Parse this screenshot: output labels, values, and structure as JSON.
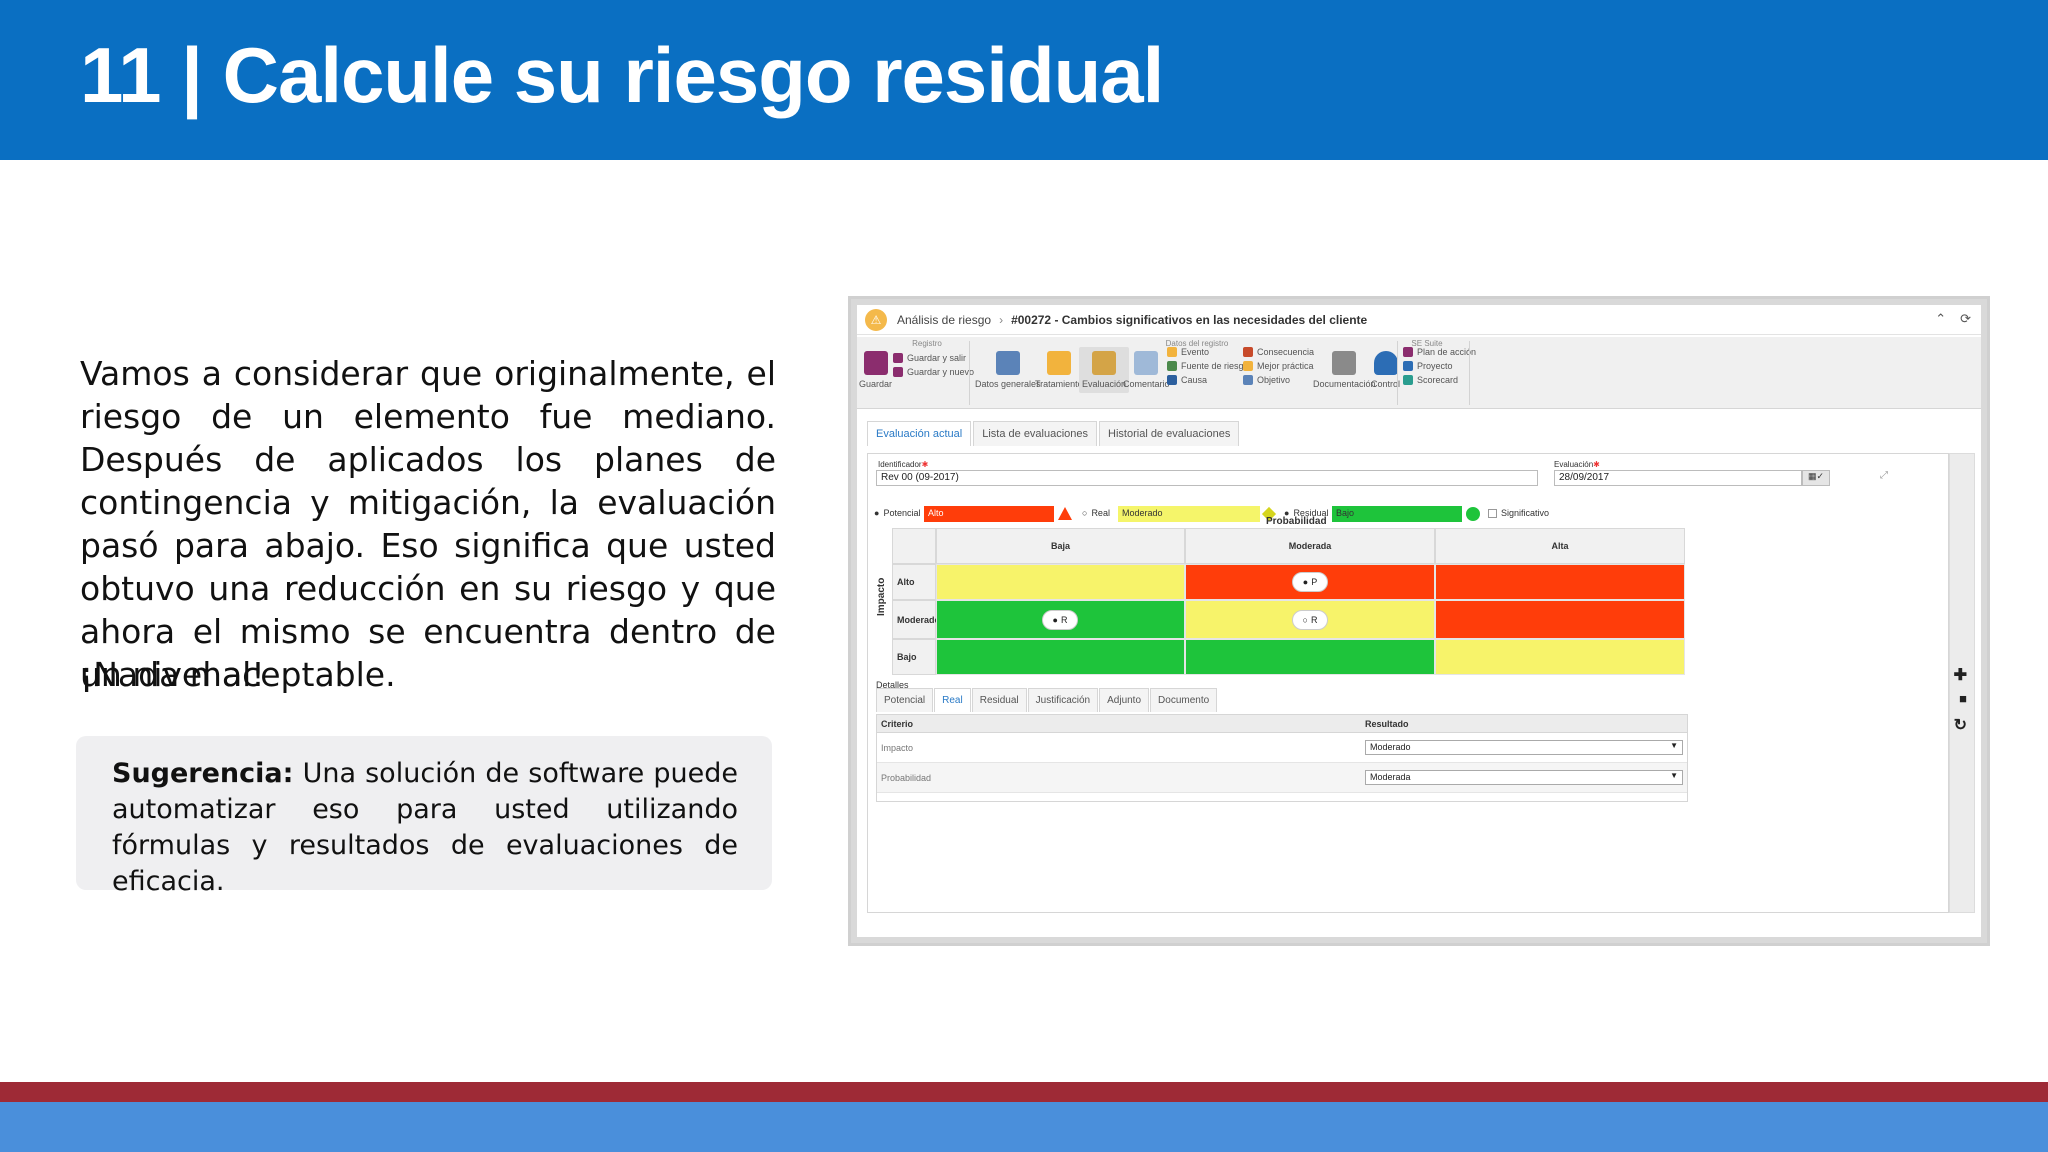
{
  "slide": {
    "title": "11 | Calcule su riesgo residual",
    "paragraph": "Vamos a considerar que originalmente, el riesgo de un elemento fue mediano. Después de aplicados los planes de contingencia y mitigación, la evaluación pasó para abajo. Eso significa que usted obtuvo una reducción en su riesgo y que ahora el mismo se encuentra dentro de un nivel aceptable.",
    "exclaim": "¡Nada mal!",
    "tip_label": "Sugerencia:",
    "tip_text": " Una solución de software puede automatizar eso para usted utilizando fórmulas y resultados de evaluaciones de eficacia.",
    "colors": {
      "header": "#0a6fc2",
      "footer_red": "#9e2a36",
      "footer_blue": "#4a8fdb"
    }
  },
  "app": {
    "breadcrumb": {
      "root": "Análisis de riesgo",
      "title": "#00272 - Cambios significativos en las necesidades del cliente"
    },
    "ribbon": {
      "groups": {
        "registro": "Registro",
        "datos": "Datos del registro",
        "suite": "SE Suite"
      },
      "guardar": "Guardar",
      "guardar_salir": "Guardar y salir",
      "guardar_nuevo": "Guardar y nuevo",
      "datos_generales": "Datos generales",
      "tratamiento": "Tratamiento",
      "evaluacion": "Evaluación",
      "comentario": "Comentario",
      "evento": "Evento",
      "fuente": "Fuente de riesgo",
      "causa": "Causa",
      "consecuencia": "Consecuencia",
      "mejor_practica": "Mejor práctica",
      "objetivo": "Objetivo",
      "documentacion": "Documentación",
      "control": "Control",
      "plan_accion": "Plan de acción",
      "proyecto": "Proyecto",
      "scorecard": "Scorecard"
    },
    "tabs": [
      "Evaluación actual",
      "Lista de evaluaciones",
      "Historial de evaluaciones"
    ],
    "form": {
      "identificador_label": "Identificador",
      "identificador_value": "Rev 00 (09-2017)",
      "evaluacion_label": "Evaluación",
      "evaluacion_value": "28/09/2017"
    },
    "levels": {
      "potencial_label": "Potencial",
      "potencial_value": "Alto",
      "real_label": "Real",
      "real_value": "Moderado",
      "residual_label": "Residual",
      "residual_value": "Bajo",
      "significativo_label": "Significativo",
      "colors": {
        "alto": "#ff3d0a",
        "moderado": "#f5f56a",
        "bajo": "#1ec43b"
      }
    },
    "matrix": {
      "x_title": "Probabilidad",
      "y_title": "Impacto",
      "columns": [
        "Baja",
        "Moderada",
        "Alta"
      ],
      "rows": [
        "Alto",
        "Moderado",
        "Bajo"
      ],
      "cells": [
        [
          "#f7f36a",
          "#ff3d0a",
          "#ff3d0a"
        ],
        [
          "#1ec43b",
          "#f7f36a",
          "#ff3d0a"
        ],
        [
          "#1ec43b",
          "#1ec43b",
          "#f7f36a"
        ]
      ],
      "markers": {
        "potencial": "P",
        "residual": "R",
        "real": "R"
      }
    },
    "details": {
      "label": "Detalles",
      "tabs": [
        "Potencial",
        "Real",
        "Residual",
        "Justificación",
        "Adjunto",
        "Documento"
      ],
      "col_criterio": "Criterio",
      "col_resultado": "Resultado",
      "rows": [
        {
          "criterio": "Impacto",
          "resultado": "Moderado"
        },
        {
          "criterio": "Probabilidad",
          "resultado": "Moderada"
        }
      ]
    }
  }
}
